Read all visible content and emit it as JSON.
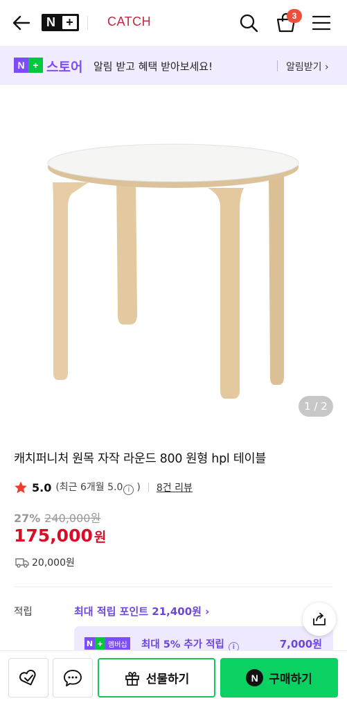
{
  "header": {
    "logo_n": "N",
    "logo_plus": "+",
    "brand": "CATCH",
    "cart_count": "3"
  },
  "notice": {
    "badge_n": "N",
    "badge_plus": "+",
    "store_label": "스토어",
    "message": "알림 받고 혜택 받아보세요!",
    "link": "알림받기 ›"
  },
  "gallery": {
    "counter": "1 / 2"
  },
  "product": {
    "title": "캐치퍼니처 원목 자작 라운드 800 원형 hpl 테이블",
    "rating_score": "5.0",
    "rating_recent": "(최근 6개월 5.0",
    "rating_recent_close": ")",
    "info_icon": "i",
    "review_link": "8건 리뷰",
    "discount_rate": "27%",
    "original_price": "240,000원",
    "price": "175,000",
    "currency": "원",
    "shipping_fee": "20,000원"
  },
  "points": {
    "label": "적립",
    "max_points": "최대 적립 포인트 21,400원 ›",
    "membership_badge_n": "N",
    "membership_badge_plus": "+",
    "membership_badge_text": "멤버십",
    "membership_text": "최대 5% 추가 적립",
    "membership_amount": "7,000원"
  },
  "bottom_bar": {
    "gift_label": "선물하기",
    "buy_label": "구매하기",
    "buy_n": "N"
  },
  "colors": {
    "accent_purple": "#7c4dff",
    "naver_green": "#0bd162",
    "price_red": "#d80d26",
    "brand_red": "#c2273a"
  }
}
